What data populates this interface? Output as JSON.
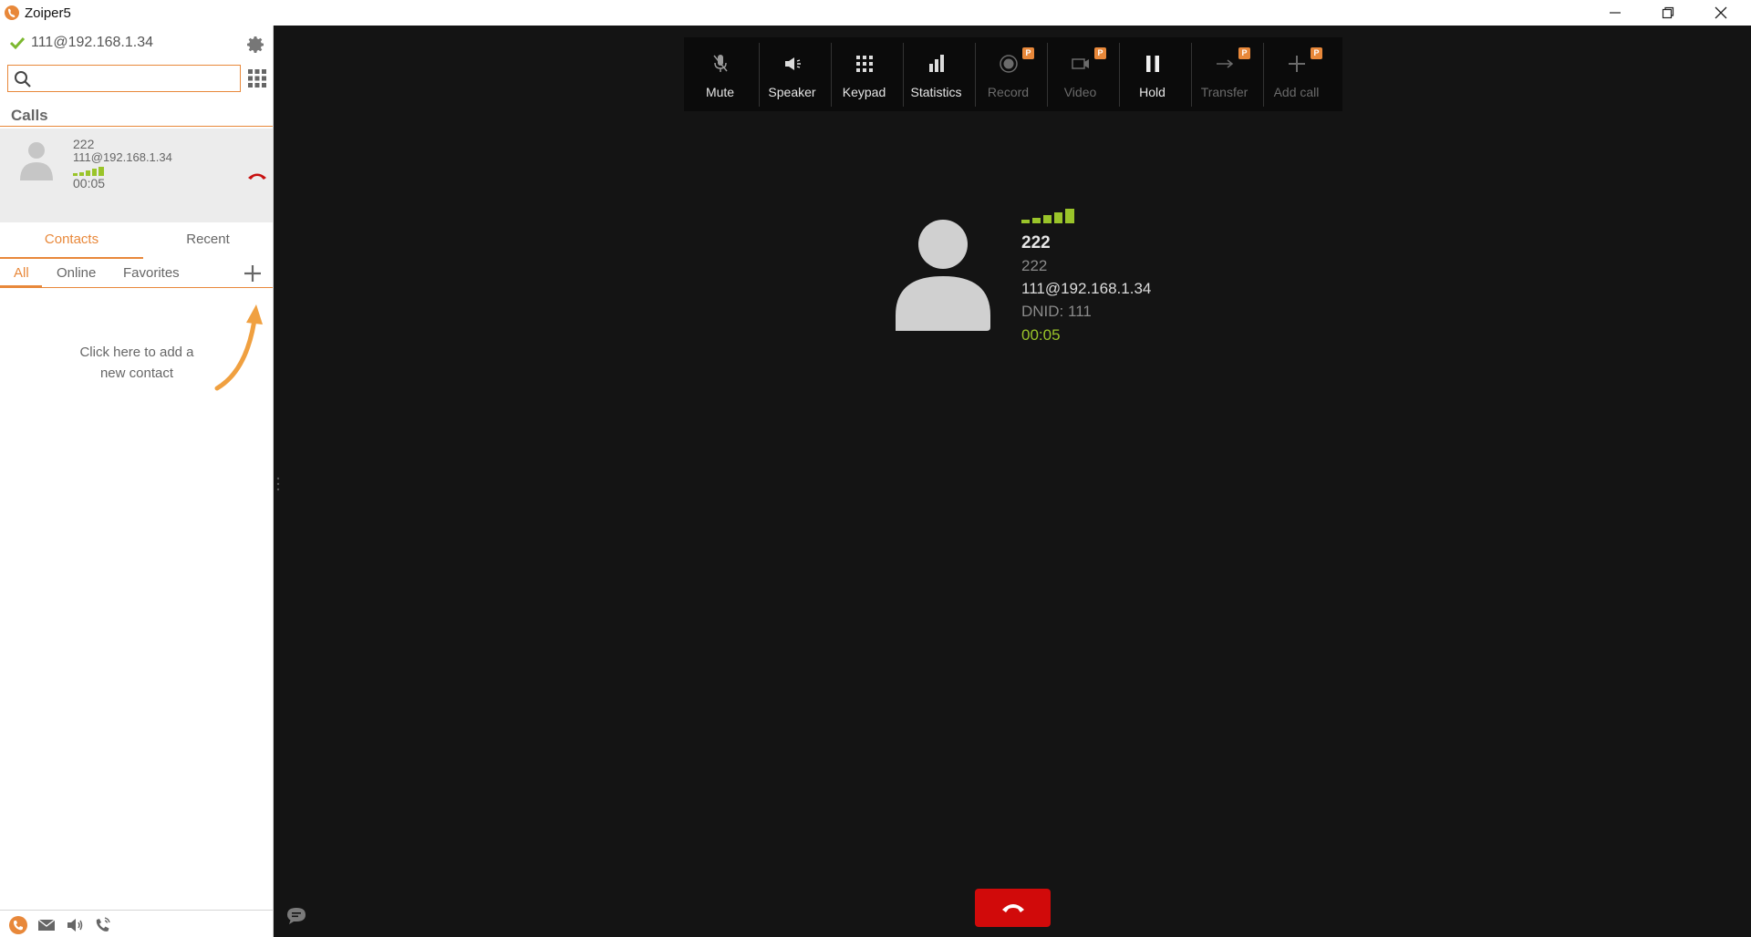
{
  "window": {
    "title": "Zoiper5"
  },
  "account": {
    "uri": "111@192.168.1.34"
  },
  "search": {
    "placeholder": "",
    "value": ""
  },
  "calls": {
    "heading": "Calls",
    "items": [
      {
        "number": "222",
        "uri": "111@192.168.1.34",
        "duration": "00:05"
      }
    ]
  },
  "contacts_tabs": {
    "contacts": "Contacts",
    "recent": "Recent"
  },
  "filters": {
    "all": "All",
    "online": "Online",
    "favorites": "Favorites"
  },
  "empty_hint": {
    "line1": "Click here to add a",
    "line2": "new contact"
  },
  "toolbar": {
    "mute": "Mute",
    "speaker": "Speaker",
    "keypad": "Keypad",
    "statistics": "Statistics",
    "record": "Record",
    "video": "Video",
    "hold": "Hold",
    "transfer": "Transfer",
    "add_call": "Add call",
    "pro_badge": "P"
  },
  "active_call": {
    "name": "222",
    "number": "222",
    "uri": "111@192.168.1.34",
    "dnid": "DNID: 111",
    "duration": "00:05"
  },
  "colors": {
    "accent": "#e8883a",
    "signal": "#9ac42a",
    "hangup": "#d10a0a",
    "background": "#141414"
  }
}
